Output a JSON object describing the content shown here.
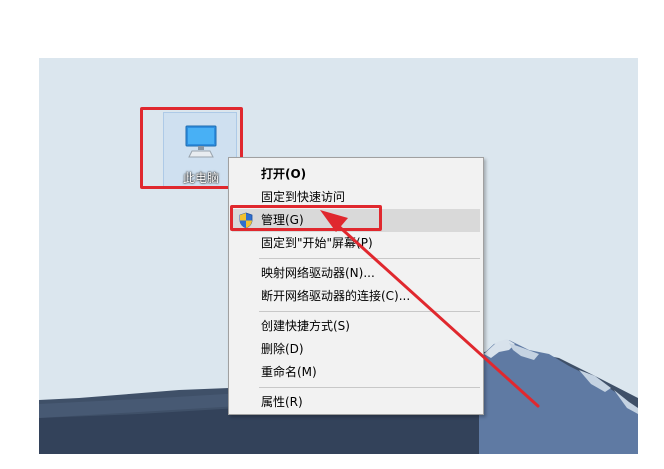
{
  "desktop": {
    "icon": {
      "label": "此电脑",
      "icon_name": "computer-monitor-icon"
    }
  },
  "context_menu": {
    "groups": [
      [
        {
          "label": "打开(O)",
          "bold": true
        },
        {
          "label": "固定到快速访问"
        },
        {
          "label": "管理(G)",
          "icon": "uac-shield-icon",
          "selected": true
        },
        {
          "label": "固定到\"开始\"屏幕(P)"
        }
      ],
      [
        {
          "label": "映射网络驱动器(N)..."
        },
        {
          "label": "断开网络驱动器的连接(C)..."
        }
      ],
      [
        {
          "label": "创建快捷方式(S)"
        },
        {
          "label": "删除(D)"
        },
        {
          "label": "重命名(M)"
        }
      ],
      [
        {
          "label": "属性(R)"
        }
      ]
    ]
  },
  "annotations": {
    "highlight_color": "#e0282e",
    "arrow_color": "#e0282e"
  },
  "colors": {
    "desktop_background": "#dbe6ee",
    "menu_background": "#f2f2f2",
    "menu_selected": "#d9d9d9",
    "mountain_dark": "#3f5068",
    "mountain_mid": "#5f7aa3"
  }
}
